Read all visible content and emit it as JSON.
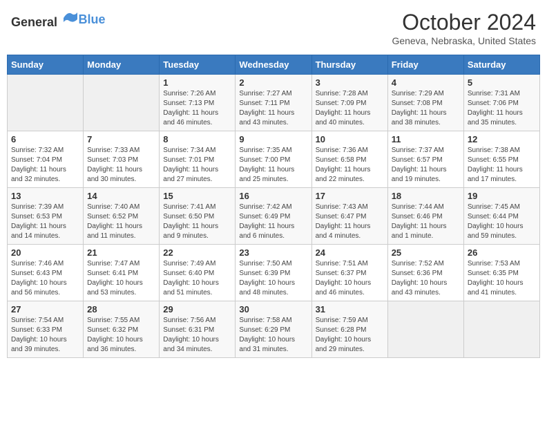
{
  "header": {
    "logo_general": "General",
    "logo_blue": "Blue",
    "title": "October 2024",
    "location": "Geneva, Nebraska, United States"
  },
  "days_of_week": [
    "Sunday",
    "Monday",
    "Tuesday",
    "Wednesday",
    "Thursday",
    "Friday",
    "Saturday"
  ],
  "weeks": [
    [
      {
        "day": "",
        "info": ""
      },
      {
        "day": "",
        "info": ""
      },
      {
        "day": "1",
        "info": "Sunrise: 7:26 AM\nSunset: 7:13 PM\nDaylight: 11 hours and 46 minutes."
      },
      {
        "day": "2",
        "info": "Sunrise: 7:27 AM\nSunset: 7:11 PM\nDaylight: 11 hours and 43 minutes."
      },
      {
        "day": "3",
        "info": "Sunrise: 7:28 AM\nSunset: 7:09 PM\nDaylight: 11 hours and 40 minutes."
      },
      {
        "day": "4",
        "info": "Sunrise: 7:29 AM\nSunset: 7:08 PM\nDaylight: 11 hours and 38 minutes."
      },
      {
        "day": "5",
        "info": "Sunrise: 7:31 AM\nSunset: 7:06 PM\nDaylight: 11 hours and 35 minutes."
      }
    ],
    [
      {
        "day": "6",
        "info": "Sunrise: 7:32 AM\nSunset: 7:04 PM\nDaylight: 11 hours and 32 minutes."
      },
      {
        "day": "7",
        "info": "Sunrise: 7:33 AM\nSunset: 7:03 PM\nDaylight: 11 hours and 30 minutes."
      },
      {
        "day": "8",
        "info": "Sunrise: 7:34 AM\nSunset: 7:01 PM\nDaylight: 11 hours and 27 minutes."
      },
      {
        "day": "9",
        "info": "Sunrise: 7:35 AM\nSunset: 7:00 PM\nDaylight: 11 hours and 25 minutes."
      },
      {
        "day": "10",
        "info": "Sunrise: 7:36 AM\nSunset: 6:58 PM\nDaylight: 11 hours and 22 minutes."
      },
      {
        "day": "11",
        "info": "Sunrise: 7:37 AM\nSunset: 6:57 PM\nDaylight: 11 hours and 19 minutes."
      },
      {
        "day": "12",
        "info": "Sunrise: 7:38 AM\nSunset: 6:55 PM\nDaylight: 11 hours and 17 minutes."
      }
    ],
    [
      {
        "day": "13",
        "info": "Sunrise: 7:39 AM\nSunset: 6:53 PM\nDaylight: 11 hours and 14 minutes."
      },
      {
        "day": "14",
        "info": "Sunrise: 7:40 AM\nSunset: 6:52 PM\nDaylight: 11 hours and 11 minutes."
      },
      {
        "day": "15",
        "info": "Sunrise: 7:41 AM\nSunset: 6:50 PM\nDaylight: 11 hours and 9 minutes."
      },
      {
        "day": "16",
        "info": "Sunrise: 7:42 AM\nSunset: 6:49 PM\nDaylight: 11 hours and 6 minutes."
      },
      {
        "day": "17",
        "info": "Sunrise: 7:43 AM\nSunset: 6:47 PM\nDaylight: 11 hours and 4 minutes."
      },
      {
        "day": "18",
        "info": "Sunrise: 7:44 AM\nSunset: 6:46 PM\nDaylight: 11 hours and 1 minute."
      },
      {
        "day": "19",
        "info": "Sunrise: 7:45 AM\nSunset: 6:44 PM\nDaylight: 10 hours and 59 minutes."
      }
    ],
    [
      {
        "day": "20",
        "info": "Sunrise: 7:46 AM\nSunset: 6:43 PM\nDaylight: 10 hours and 56 minutes."
      },
      {
        "day": "21",
        "info": "Sunrise: 7:47 AM\nSunset: 6:41 PM\nDaylight: 10 hours and 53 minutes."
      },
      {
        "day": "22",
        "info": "Sunrise: 7:49 AM\nSunset: 6:40 PM\nDaylight: 10 hours and 51 minutes."
      },
      {
        "day": "23",
        "info": "Sunrise: 7:50 AM\nSunset: 6:39 PM\nDaylight: 10 hours and 48 minutes."
      },
      {
        "day": "24",
        "info": "Sunrise: 7:51 AM\nSunset: 6:37 PM\nDaylight: 10 hours and 46 minutes."
      },
      {
        "day": "25",
        "info": "Sunrise: 7:52 AM\nSunset: 6:36 PM\nDaylight: 10 hours and 43 minutes."
      },
      {
        "day": "26",
        "info": "Sunrise: 7:53 AM\nSunset: 6:35 PM\nDaylight: 10 hours and 41 minutes."
      }
    ],
    [
      {
        "day": "27",
        "info": "Sunrise: 7:54 AM\nSunset: 6:33 PM\nDaylight: 10 hours and 39 minutes."
      },
      {
        "day": "28",
        "info": "Sunrise: 7:55 AM\nSunset: 6:32 PM\nDaylight: 10 hours and 36 minutes."
      },
      {
        "day": "29",
        "info": "Sunrise: 7:56 AM\nSunset: 6:31 PM\nDaylight: 10 hours and 34 minutes."
      },
      {
        "day": "30",
        "info": "Sunrise: 7:58 AM\nSunset: 6:29 PM\nDaylight: 10 hours and 31 minutes."
      },
      {
        "day": "31",
        "info": "Sunrise: 7:59 AM\nSunset: 6:28 PM\nDaylight: 10 hours and 29 minutes."
      },
      {
        "day": "",
        "info": ""
      },
      {
        "day": "",
        "info": ""
      }
    ]
  ]
}
